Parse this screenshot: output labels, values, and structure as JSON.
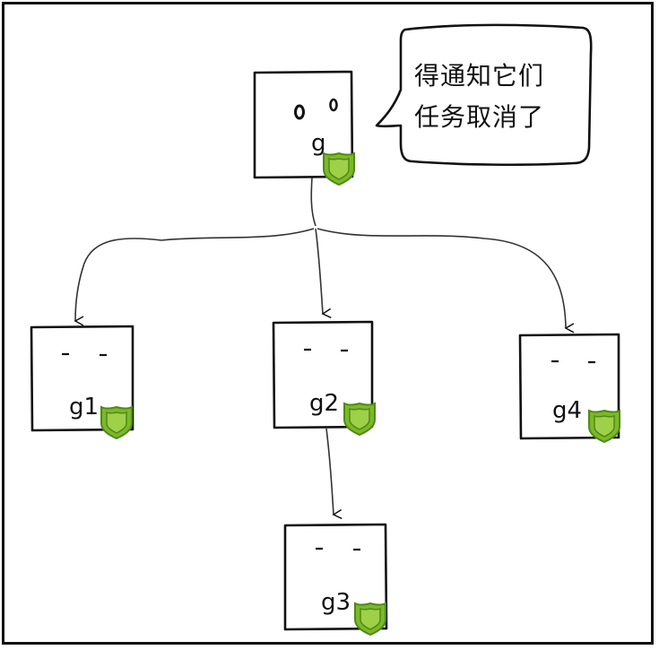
{
  "nodes": {
    "root": {
      "label": "g"
    },
    "g1": {
      "label": "g1"
    },
    "g2": {
      "label": "g2"
    },
    "g3": {
      "label": "g3"
    },
    "g4": {
      "label": "g4"
    }
  },
  "speech_bubble": {
    "line1": "得通知它们",
    "line2": "任务取消了"
  },
  "colors": {
    "shield_fill": "#7db82a",
    "shield_dark": "#4f8a14",
    "ink": "#111111"
  }
}
